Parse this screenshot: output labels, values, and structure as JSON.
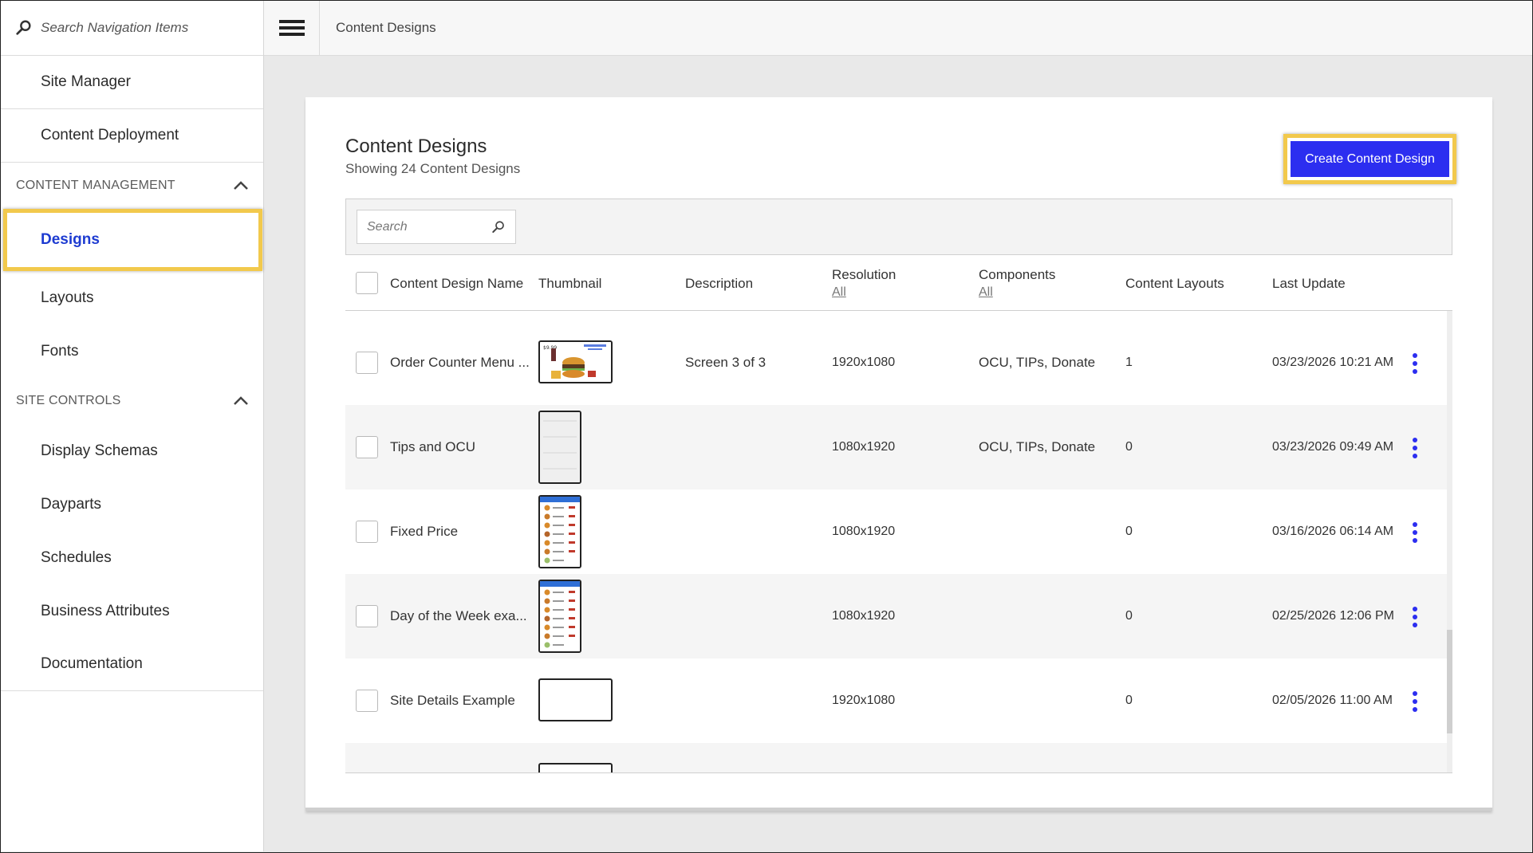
{
  "sidebar": {
    "search_placeholder": "Search Navigation Items",
    "top_items": [
      "Site Manager",
      "Content Deployment"
    ],
    "content_management": {
      "title": "CONTENT MANAGEMENT",
      "items": [
        "Designs",
        "Layouts",
        "Fonts"
      ]
    },
    "site_controls": {
      "title": "SITE CONTROLS",
      "items": [
        "Display Schemas",
        "Dayparts",
        "Schedules",
        "Business Attributes"
      ]
    },
    "bottom_items": [
      "Documentation"
    ]
  },
  "topbar": {
    "title": "Content Designs"
  },
  "main": {
    "title": "Content Designs",
    "subtitle": "Showing 24 Content Designs",
    "create_button": "Create Content Design",
    "search_placeholder": "Search",
    "columns": {
      "name": "Content Design Name",
      "thumbnail": "Thumbnail",
      "description": "Description",
      "resolution": "Resolution",
      "resolution_filter": "All",
      "components": "Components",
      "components_filter": "All",
      "layouts": "Content Layouts",
      "last_update": "Last Update"
    },
    "rows": [
      {
        "name": "Order Counter Menu ...",
        "thumb": "landscape-menu",
        "description": "Screen 3 of 3",
        "resolution": "1920x1080",
        "components": "OCU, TIPs, Donate",
        "layouts": "1",
        "updated": "03/23/2026 10:21 AM"
      },
      {
        "name": "Tips and OCU",
        "thumb": "portrait-blank",
        "description": "",
        "resolution": "1080x1920",
        "components": "OCU, TIPs, Donate",
        "layouts": "0",
        "updated": "03/23/2026 09:49 AM"
      },
      {
        "name": "Fixed Price",
        "thumb": "portrait-menu",
        "description": "",
        "resolution": "1080x1920",
        "components": "",
        "layouts": "0",
        "updated": "03/16/2026 06:14 AM"
      },
      {
        "name": "Day of the Week exa...",
        "thumb": "portrait-menu",
        "description": "",
        "resolution": "1080x1920",
        "components": "",
        "layouts": "0",
        "updated": "02/25/2026 12:06 PM"
      },
      {
        "name": "Site Details Example",
        "thumb": "landscape-blank",
        "description": "",
        "resolution": "1920x1080",
        "components": "",
        "layouts": "0",
        "updated": "02/05/2026 11:00 AM"
      }
    ]
  },
  "colors": {
    "accent": "#2c2ef0",
    "active_nav": "#1d3bd1",
    "highlight": "#f2c94c"
  }
}
